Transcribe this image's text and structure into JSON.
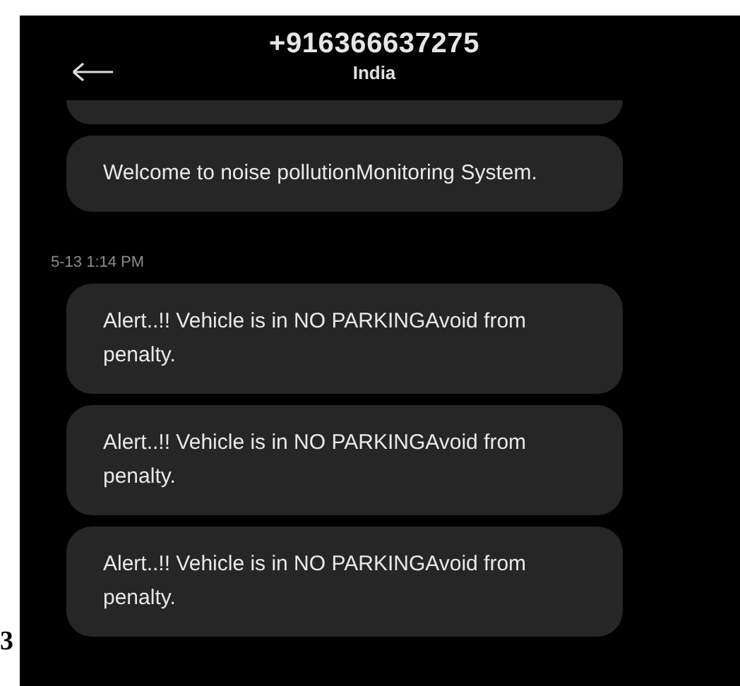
{
  "page_number": "3",
  "header": {
    "title": "+916366637275",
    "subtitle": "India"
  },
  "messages": [
    {
      "kind": "clipped"
    },
    {
      "kind": "text",
      "text": "Welcome to noise pollutionMonitoring System."
    },
    {
      "kind": "timestamp",
      "text": "5-13 1:14 PM"
    },
    {
      "kind": "text",
      "text": "Alert..!! Vehicle is in NO PARKINGAvoid from penalty."
    },
    {
      "kind": "text",
      "text": "Alert..!! Vehicle is in NO PARKINGAvoid from penalty."
    },
    {
      "kind": "text",
      "text": "Alert..!! Vehicle is in NO PARKINGAvoid from penalty."
    }
  ]
}
